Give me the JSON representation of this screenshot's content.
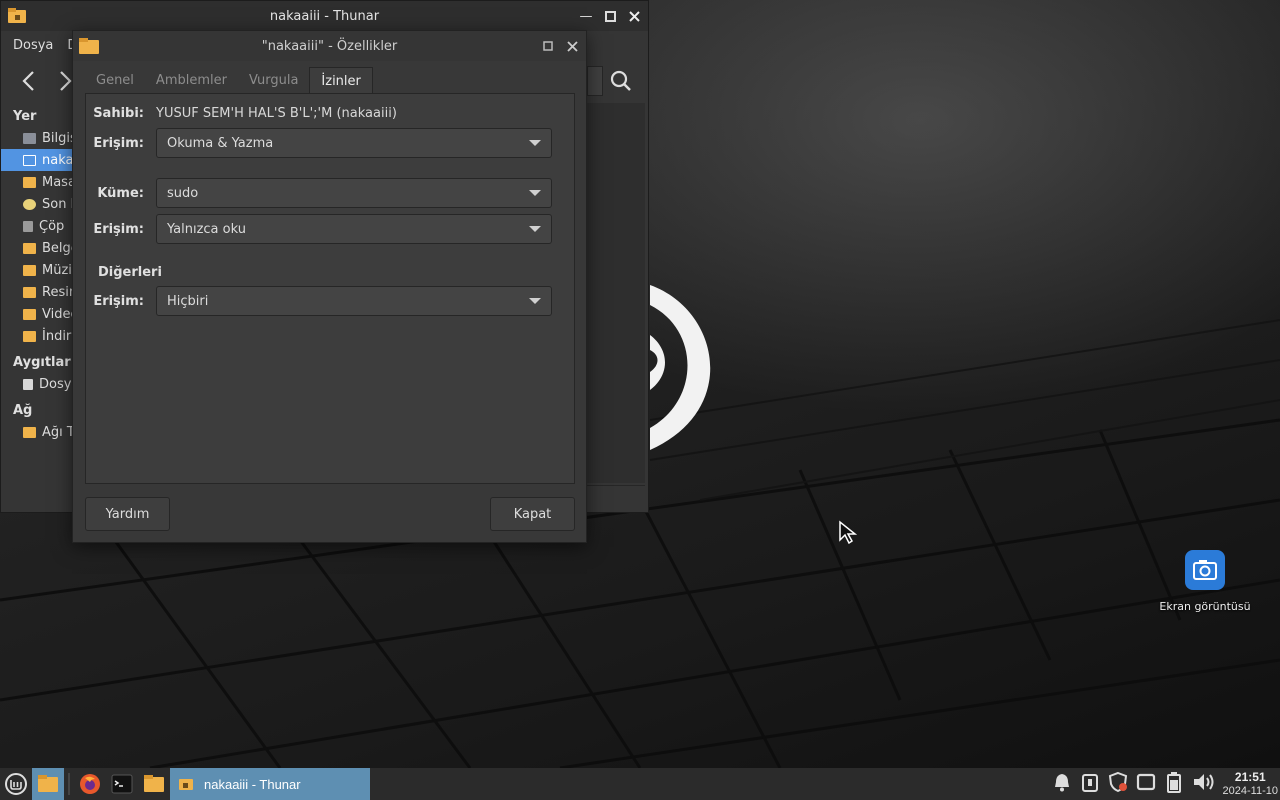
{
  "desktop": {
    "icon_label": "Ekran görüntüsü"
  },
  "thunar": {
    "title": "nakaaiii - Thunar",
    "menu": [
      "Dosya",
      "D"
    ],
    "sidebar": {
      "sections": [
        {
          "title": "Yer",
          "items": [
            {
              "label": "Bilgis",
              "icon": "computer-icon",
              "selected": false
            },
            {
              "label": "nakaa",
              "icon": "home-icon",
              "selected": true
            },
            {
              "label": "Masa",
              "icon": "desktop-folder-icon",
              "selected": false
            },
            {
              "label": "Son k",
              "icon": "recent-icon",
              "selected": false
            },
            {
              "label": "Çöp",
              "icon": "trash-icon",
              "selected": false
            },
            {
              "label": "Belge",
              "icon": "documents-folder-icon",
              "selected": false
            },
            {
              "label": "Müzil",
              "icon": "music-folder-icon",
              "selected": false
            },
            {
              "label": "Resim",
              "icon": "pictures-folder-icon",
              "selected": false
            },
            {
              "label": "Videc",
              "icon": "videos-folder-icon",
              "selected": false
            },
            {
              "label": "İndiri",
              "icon": "downloads-folder-icon",
              "selected": false
            }
          ]
        },
        {
          "title": "Aygıtlar",
          "items": [
            {
              "label": "Dosya",
              "icon": "filesystem-icon",
              "selected": false
            }
          ]
        },
        {
          "title": "Ağ",
          "items": [
            {
              "label": "Ağı Ta",
              "icon": "network-folder-icon",
              "selected": false
            }
          ]
        }
      ]
    }
  },
  "dialog": {
    "title": "\"nakaaiii\" - Özellikler",
    "tabs": [
      {
        "label": "Genel",
        "active": false
      },
      {
        "label": "Amblemler",
        "active": false
      },
      {
        "label": "Vurgula",
        "active": false
      },
      {
        "label": "İzinler",
        "active": true
      }
    ],
    "owner_label": "Sahibi:",
    "owner_value": "YUSUF SEM'H HAL'S B'L';'M (nakaaiii)",
    "owner_access_label": "Erişim:",
    "owner_access": "Okuma & Yazma",
    "group_label": "Küme:",
    "group_value": "sudo",
    "group_access_label": "Erişim:",
    "group_access": "Yalnızca oku",
    "others_label": "Diğerleri",
    "others_access_label": "Erişim:",
    "others_access": "Hiçbiri",
    "help_button": "Yardım",
    "close_button": "Kapat"
  },
  "taskbar": {
    "active_task": "nakaaiii - Thunar",
    "clock_time": "21:51",
    "clock_date": "2024-11-10"
  },
  "colors": {
    "selection": "#5294e2",
    "task_active": "#5e8fb2",
    "folder": "#f0b34a"
  }
}
